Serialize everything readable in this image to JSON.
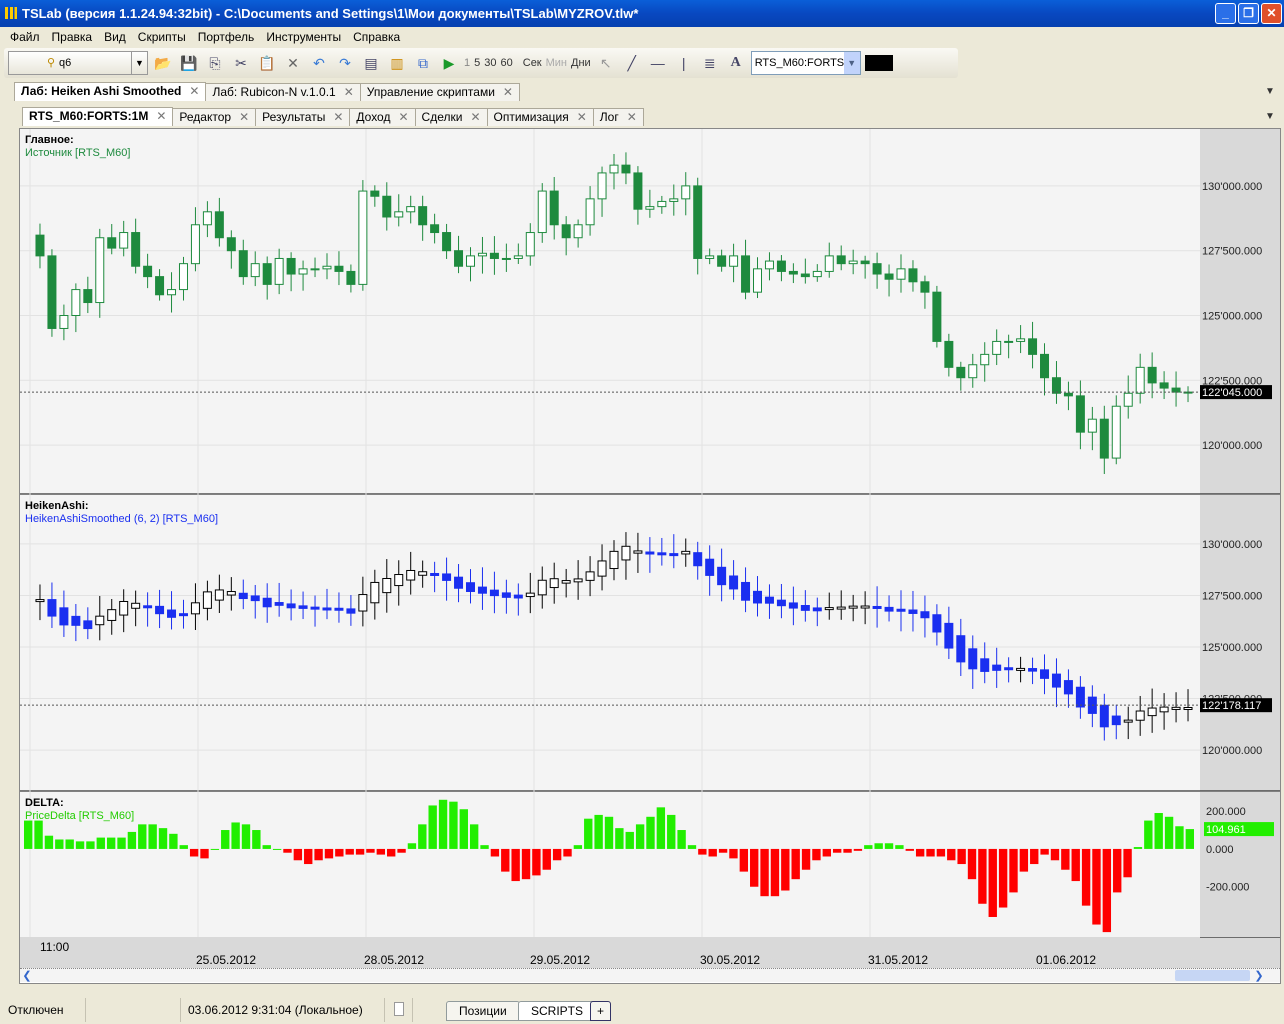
{
  "window": {
    "title": "TSLab (версия 1.1.24.94:32bit) - C:\\Documents and Settings\\1\\Мои документы\\TSLab\\MYZROV.tlw*"
  },
  "menu": [
    "Файл",
    "Правка",
    "Вид",
    "Скрипты",
    "Портфель",
    "Инструменты",
    "Справка"
  ],
  "toolbar": {
    "profile": "q6",
    "intervals": [
      "1",
      "5",
      "30",
      "60"
    ],
    "units": [
      "Сек",
      "Мин",
      "Дни"
    ],
    "symbol": "RTS_M60:FORTS"
  },
  "tabs_top": [
    {
      "label": "Лаб: Heiken Ashi Smoothed",
      "active": true
    },
    {
      "label": "Лаб: Rubicon-N v.1.0.1"
    },
    {
      "label": "Управление скриптами"
    }
  ],
  "tabs_inner": [
    {
      "label": "RTS_M60:FORTS:1M",
      "active": true
    },
    {
      "label": "Редактор"
    },
    {
      "label": "Результаты"
    },
    {
      "label": "Доход"
    },
    {
      "label": "Сделки"
    },
    {
      "label": "Оптимизация"
    },
    {
      "label": "Лог"
    }
  ],
  "colors": {
    "bull": "#ffffff",
    "bear": "#1e8a3e",
    "ha_bear": "#1a2ff0",
    "delta_pos": "#22ee00",
    "delta_neg": "#ff0000"
  },
  "panels": {
    "main": {
      "title": "Главное:",
      "series": "Источник [RTS_M60]",
      "last": "122'045.000",
      "ticks": [
        "130'000.000",
        "127'500.000",
        "125'000.000",
        "122'500.000",
        "120'000.000"
      ]
    },
    "ha": {
      "title": "HeikenAshi:",
      "series": "HeikenAshiSmoothed (6, 2) [RTS_M60]",
      "last": "122'178.117",
      "ticks": [
        "130'000.000",
        "127'500.000",
        "125'000.000",
        "122'500.000",
        "120'000.000"
      ]
    },
    "delta": {
      "title": "DELTA:",
      "series": "PriceDelta [RTS_M60]",
      "last": "104.961",
      "ticks": [
        "200.000",
        "0.000",
        "-200.000"
      ]
    }
  },
  "time_axis": {
    "first": "11:00",
    "dates": [
      "25.05.2012",
      "28.05.2012",
      "29.05.2012",
      "30.05.2012",
      "31.05.2012",
      "01.06.2012"
    ]
  },
  "chart_data": {
    "type": "candlestick",
    "price_range": [
      118500,
      131500
    ],
    "closes": [
      127300,
      124500,
      125000,
      126000,
      125500,
      128000,
      127600,
      128200,
      126900,
      126500,
      125800,
      126000,
      127000,
      128500,
      129000,
      128000,
      127500,
      126500,
      127000,
      126200,
      127200,
      126600,
      126800,
      126800,
      126900,
      126700,
      126200,
      129800,
      129600,
      128800,
      129000,
      129200,
      128500,
      128200,
      127500,
      126900,
      127300,
      127400,
      127200,
      127200,
      127300,
      128200,
      129800,
      128500,
      128000,
      128500,
      129500,
      130500,
      130800,
      130500,
      129100,
      129200,
      129400,
      129500,
      130000,
      127200,
      127300,
      126900,
      127300,
      125900,
      126800,
      127100,
      126700,
      126600,
      126500,
      126700,
      127300,
      127000,
      127100,
      127000,
      126600,
      126400,
      126800,
      126300,
      125900,
      124000,
      123000,
      122600,
      123100,
      123500,
      124000,
      124000,
      124100,
      123500,
      122600,
      122000,
      121900,
      120500,
      121000,
      119500,
      121500,
      122000,
      123000,
      122400,
      122200,
      122045,
      122045
    ],
    "delta_range": [
      -450,
      280
    ],
    "delta": [
      150,
      150,
      70,
      50,
      50,
      40,
      40,
      60,
      60,
      60,
      90,
      130,
      130,
      110,
      80,
      20,
      -40,
      -50,
      0,
      100,
      140,
      130,
      100,
      20,
      0,
      -20,
      -60,
      -80,
      -60,
      -50,
      -40,
      -30,
      -30,
      -20,
      -30,
      -40,
      -20,
      30,
      130,
      230,
      260,
      250,
      210,
      130,
      20,
      -40,
      -120,
      -170,
      -160,
      -140,
      -110,
      -60,
      -40,
      20,
      160,
      180,
      170,
      110,
      90,
      130,
      170,
      220,
      180,
      100,
      20,
      -30,
      -40,
      -20,
      -50,
      -120,
      -200,
      -250,
      -250,
      -220,
      -160,
      -110,
      -60,
      -40,
      -20,
      -20,
      -10,
      20,
      30,
      30,
      20,
      -10,
      -40,
      -40,
      -40,
      -60,
      -80,
      -160,
      -290,
      -360,
      -310,
      -230,
      -120,
      -80,
      -30,
      -60,
      -110,
      -170,
      -300,
      -400,
      -440,
      -230,
      -150,
      10,
      150,
      190,
      170,
      120,
      105
    ]
  },
  "status": {
    "connection": "Отключен",
    "datetime": "03.06.2012 9:31:04 (Локальное)",
    "tabs": [
      "Позиции",
      "SCRIPTS",
      "+"
    ]
  }
}
